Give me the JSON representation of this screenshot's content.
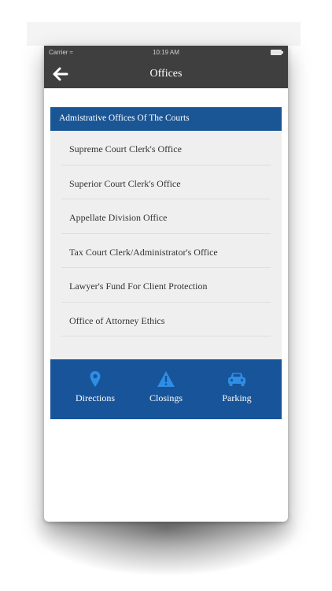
{
  "status_bar": {
    "carrier": "Carrier",
    "time": "10:19 AM"
  },
  "nav": {
    "title": "Offices",
    "back_icon": "arrow-left-icon"
  },
  "section": {
    "header": "Admistrative Offices Of The Courts",
    "items": [
      {
        "label": "Supreme Court Clerk's Office"
      },
      {
        "label": "Superior Court Clerk's Office"
      },
      {
        "label": "Appellate Division Office"
      },
      {
        "label": "Tax Court Clerk/Administrator's Office"
      },
      {
        "label": "Lawyer's Fund For Client Protection"
      },
      {
        "label": "Office of Attorney Ethics"
      }
    ]
  },
  "actions": [
    {
      "label": "Directions",
      "icon": "map-pin-icon"
    },
    {
      "label": "Closings",
      "icon": "warning-icon"
    },
    {
      "label": "Parking",
      "icon": "car-icon"
    }
  ],
  "colors": {
    "nav_bg": "#3f3f3f",
    "accent": "#17549a",
    "icon_blue": "#2f8de4",
    "list_bg": "#efefef"
  }
}
